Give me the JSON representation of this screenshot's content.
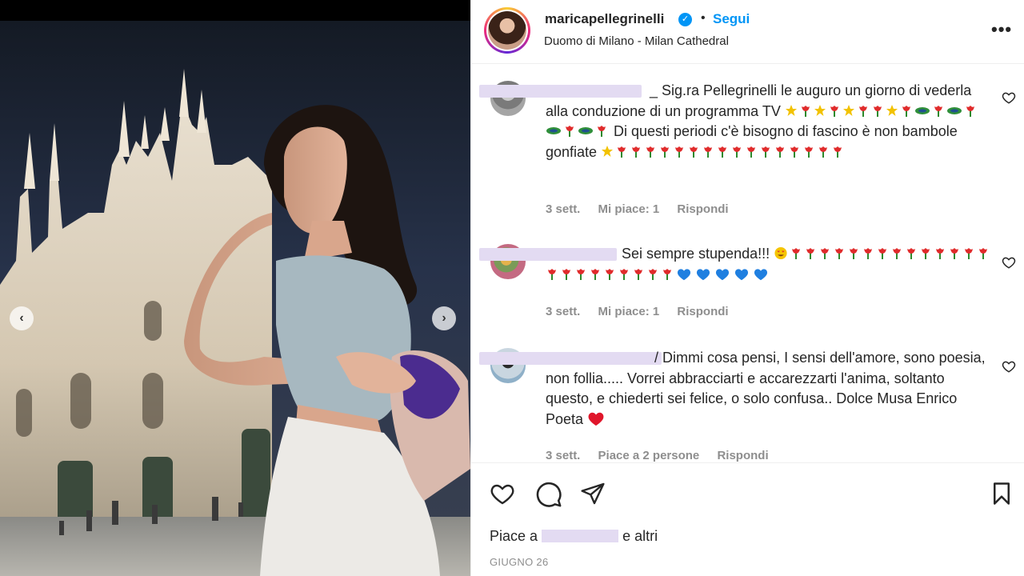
{
  "post": {
    "username": "maricapellegrinelli",
    "verified_badge": "verified-icon",
    "separator": "•",
    "follow_label": "Segui",
    "location": "Duomo di Milano - Milan Cathedral",
    "more_label": "•••"
  },
  "carousel": {
    "prev_label": "‹",
    "next_label": "›"
  },
  "comments": [
    {
      "visible_name_tail": "_",
      "text": "Sig.ra Pellegrinelli le auguro un giorno di vederla alla conduzione di un programma TV",
      "text_after_emoji_1": "Di questi periodi c'è bisogno di fascino è non bambole gonfiate",
      "emoji_line": "flowers",
      "time": "3 sett.",
      "likes": "Mi piace: 1",
      "reply": "Rispondi"
    },
    {
      "visible_name_tail": "",
      "text": "Sei sempre stupenda!!!",
      "emoji_line": "hearts",
      "time": "3 sett.",
      "likes": "Mi piace: 1",
      "reply": "Rispondi"
    },
    {
      "visible_name_tail": "/",
      "text": "Dimmi cosa pensi, I sensi dell'amore, sono poesia, non follia..... Vorrei abbracciarti e accarezzarti l'anima, soltanto questo, e chiederti sei felice, o solo confusa.. Dolce Musa Enrico Poeta",
      "time": "3 sett.",
      "likes": "Piace a 2 persone",
      "reply": "Rispondi"
    }
  ],
  "footer": {
    "likes_prefix": "Piace a",
    "likes_suffix": "e altri",
    "date": "GIUGNO 26"
  },
  "colors": {
    "accent": "#0095f6",
    "text": "#262626",
    "muted": "#8e8e8e",
    "heart": "#ed4956"
  }
}
